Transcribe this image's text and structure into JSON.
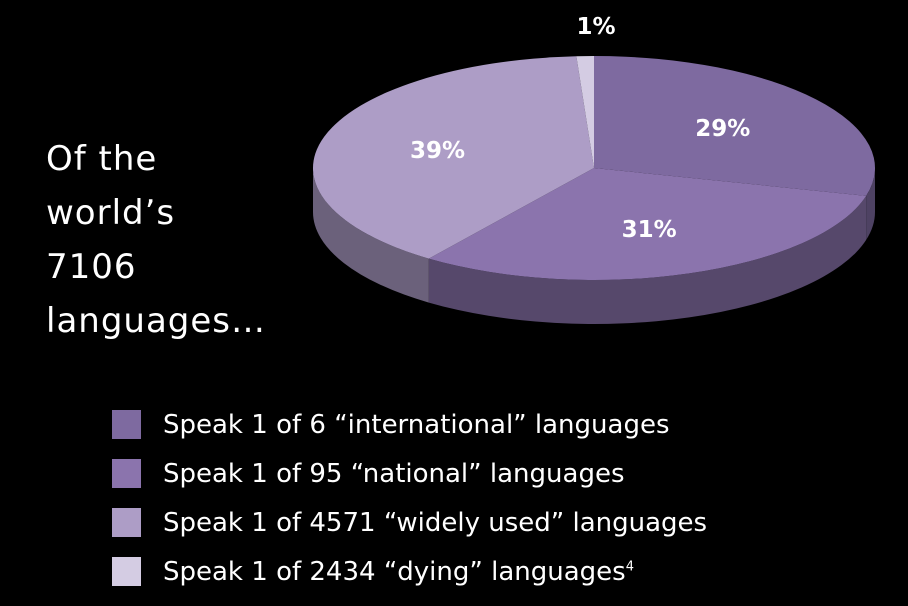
{
  "heading": {
    "lines": [
      "Of the",
      "world’s",
      "7106",
      "languages…"
    ]
  },
  "chart_data": {
    "type": "pie",
    "title": "Of the world’s 7106 languages…",
    "categories": [
      "Speak 1 of 6 “international” languages",
      "Speak 1 of 95 “national” languages",
      "Speak 1 of 4571 “widely used” languages",
      "Speak 1 of 2434 “dying” languages"
    ],
    "values": [
      29,
      31,
      39,
      1
    ],
    "value_labels": [
      "29%",
      "31%",
      "39%",
      "1%"
    ],
    "colors": [
      "#7e6aa0",
      "#8b74ad",
      "#ad9dc6",
      "#d4cce3"
    ],
    "legend_position": "bottom",
    "legend_footnote": "4"
  }
}
